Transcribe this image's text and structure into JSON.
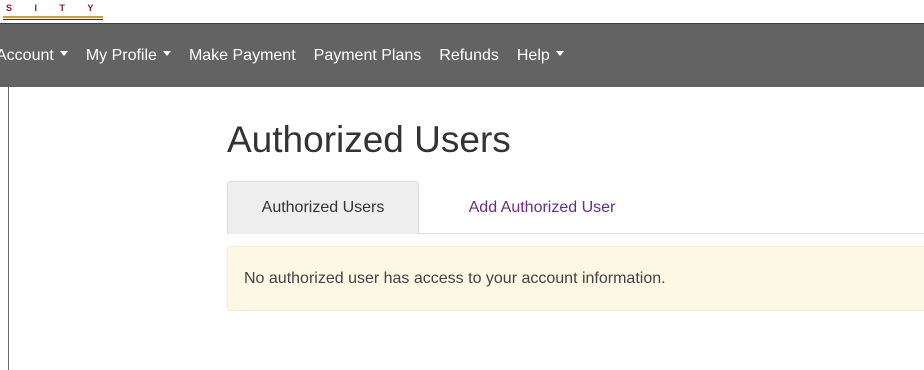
{
  "branding": {
    "logo_text": "S I T Y"
  },
  "navbar": {
    "items": [
      {
        "label": "Account",
        "dropdown": true
      },
      {
        "label": "My Profile",
        "dropdown": true
      },
      {
        "label": "Make Payment",
        "dropdown": false
      },
      {
        "label": "Payment Plans",
        "dropdown": false
      },
      {
        "label": "Refunds",
        "dropdown": false
      },
      {
        "label": "Help",
        "dropdown": true
      }
    ]
  },
  "main": {
    "title": "Authorized Users",
    "tabs": [
      {
        "label": "Authorized Users",
        "active": true
      },
      {
        "label": "Add Authorized User",
        "active": false
      }
    ],
    "alert_message": "No authorized user has access to your account information."
  },
  "colors": {
    "navbar_bg": "#636363",
    "tab_link": "#6b2a8f",
    "alert_bg": "#fcf8e3",
    "alert_border": "#faebcc"
  }
}
